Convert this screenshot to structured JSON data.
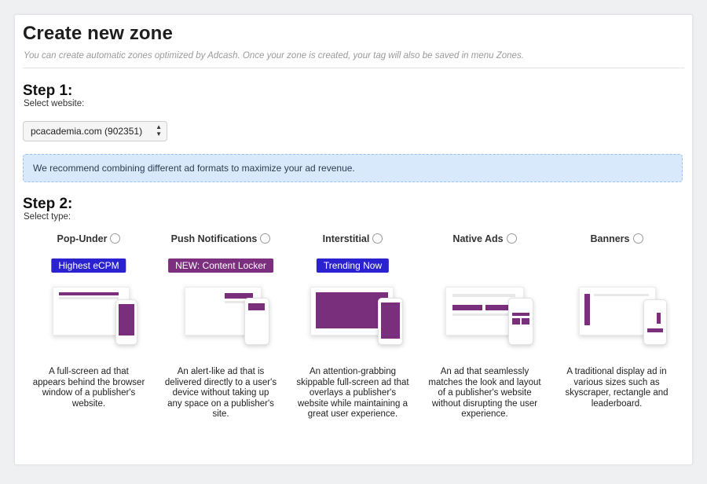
{
  "header": {
    "title": "Create new zone",
    "subtitle": "You can create automatic zones optimized by Adcash. Once your zone is created, your tag will also be saved in menu Zones."
  },
  "step1": {
    "title": "Step 1:",
    "label": "Select website:",
    "selected_website": "pcacademia.com (902351)"
  },
  "notice": "We recommend combining different ad formats to maximize your ad revenue.",
  "step2": {
    "title": "Step 2:",
    "label": "Select type:",
    "types": [
      {
        "name": "Pop-Under",
        "badge": "Highest eCPM",
        "badge_color": "#2a22d0",
        "icon": "pop-under-illustration",
        "desc_lines": [
          "A full-screen ad that",
          "appears behind the browser",
          "window of a publisher's",
          "website."
        ]
      },
      {
        "name": "Push Notifications",
        "badge": "NEW: Content Locker",
        "badge_color": "#7b2f7e",
        "icon": "push-notification-illustration",
        "desc_lines": [
          "An alert-like ad that is",
          "delivered directly to a user's",
          "device without taking up",
          "any space on a publisher's",
          "site."
        ]
      },
      {
        "name": "Interstitial",
        "badge": "Trending Now",
        "badge_color": "#2a22d0",
        "icon": "interstitial-illustration",
        "desc_lines": [
          "An attention-grabbing",
          "skippable full-screen ad that",
          "overlays a publisher's",
          "website while maintaining a",
          "great user experience."
        ]
      },
      {
        "name": "Native Ads",
        "badge": "",
        "badge_color": "",
        "icon": "native-ads-illustration",
        "desc_lines": [
          "An ad that seamlessly",
          "matches the look and layout",
          "of a publisher's website",
          "without disrupting the user",
          "experience."
        ]
      },
      {
        "name": "Banners",
        "badge": "",
        "badge_color": "",
        "icon": "banners-illustration",
        "desc_lines": [
          "A traditional display ad in",
          "various sizes such as",
          "skyscraper, rectangle and",
          "leaderboard."
        ]
      }
    ]
  },
  "colors": {
    "accent_purple": "#7a2f7d",
    "badge_blue": "#2a22d0",
    "notice_bg": "#d8e9fb"
  }
}
